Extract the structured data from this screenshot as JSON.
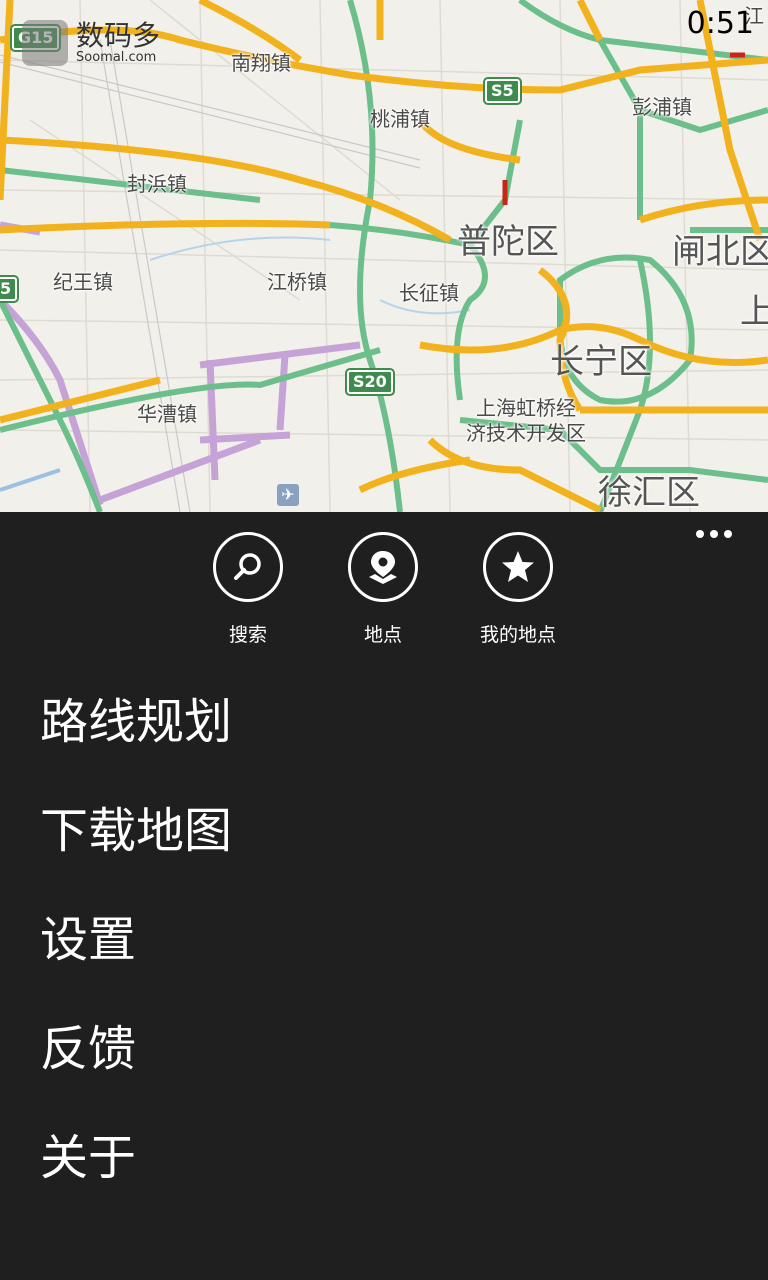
{
  "map": {
    "towns": [
      "南翔镇",
      "桃浦镇",
      "彭浦镇",
      "封浜镇",
      "纪王镇",
      "江桥镇",
      "长征镇",
      "华漕镇"
    ],
    "districts": [
      "普陀区",
      "闸北区",
      "长宁区",
      "徐汇区"
    ],
    "zone": [
      "上海虹桥经",
      "济技术开发区"
    ],
    "shields": [
      "G15",
      "S5",
      "S20",
      "5"
    ],
    "edge_labels": [
      "江",
      "上"
    ],
    "airport_icon": "airplane-icon"
  },
  "watermark": {
    "title": "数码多",
    "subtitle": "Soomal.com"
  },
  "status": {
    "time": "0:51"
  },
  "appbar": {
    "buttons": [
      {
        "label": "搜索",
        "icon": "search-icon"
      },
      {
        "label": "地点",
        "icon": "location-pin-icon"
      },
      {
        "label": "我的地点",
        "icon": "star-icon"
      }
    ],
    "more_icon": "ellipsis-icon"
  },
  "menu": {
    "items": [
      "路线规划",
      "下载地图",
      "设置",
      "反馈",
      "关于"
    ]
  },
  "colors": {
    "background": "#1f1f1f",
    "map_background": "#f2f0ea",
    "highway_yellow": "#f2b21d",
    "expressway_green": "#6cbf8a",
    "railway_purple": "#c6a3d6",
    "foreground": "#ffffff"
  }
}
